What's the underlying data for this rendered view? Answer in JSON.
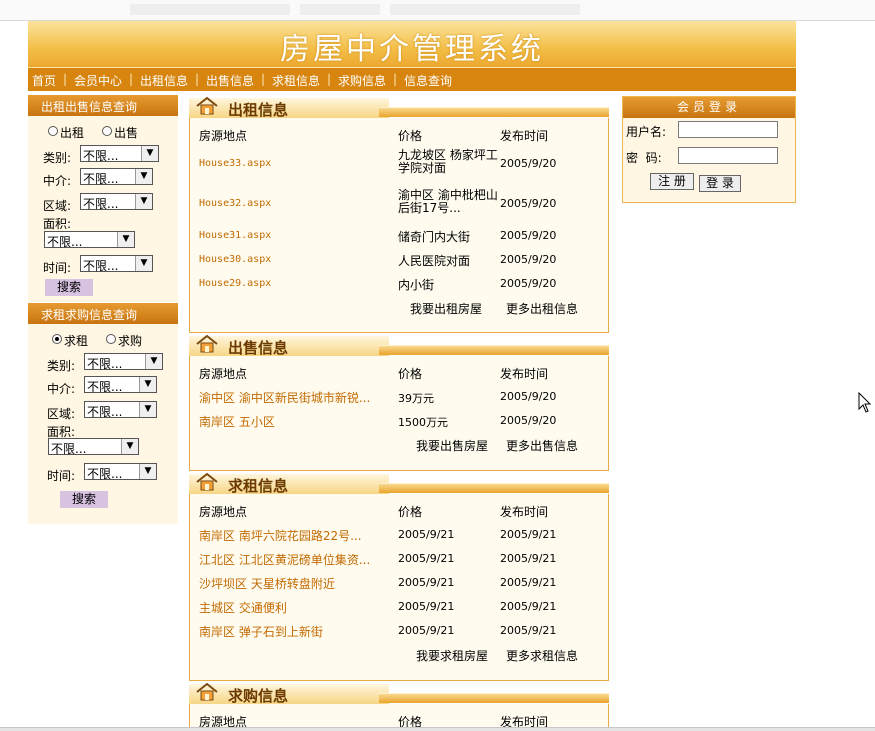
{
  "header": {
    "title": "房屋中介管理系统"
  },
  "nav": [
    "首页",
    "会员中心",
    "出租信息",
    "出售信息",
    "求租信息",
    "求购信息",
    "信息查询"
  ],
  "sidebar": {
    "rent_sale_search": {
      "heading": "出租出售信息查询",
      "radios": [
        {
          "label": "出租",
          "checked": false
        },
        {
          "label": "出售",
          "checked": false
        }
      ],
      "fields": {
        "category": "类别:",
        "agency": "中介:",
        "area": "区域:",
        "size": "面积:",
        "time": "时间:"
      },
      "select_value": "不限...",
      "search_label": "搜索"
    },
    "want_search": {
      "heading": "求租求购信息查询",
      "radios": [
        {
          "label": "求租",
          "checked": true
        },
        {
          "label": "求购",
          "checked": false
        }
      ],
      "fields": {
        "category": "类别:",
        "agency": "中介:",
        "area": "区域:",
        "size": "面积:",
        "time": "时间:"
      },
      "select_value": "不限...",
      "search_label": "搜索"
    }
  },
  "columns": {
    "location": "房源地点",
    "price": "价格",
    "date": "发布时间"
  },
  "rent": {
    "title": "出租信息",
    "rows": [
      {
        "location": "House33.aspx",
        "price": "九龙坡区 杨家坪工学院对面",
        "date": "2005/9/20"
      },
      {
        "location": "House32.aspx",
        "price": "渝中区 渝中枇杷山后街17号...",
        "date": "2005/9/20"
      },
      {
        "location": "House31.aspx",
        "price": "储奇门内大街",
        "date": "2005/9/20"
      },
      {
        "location": "House30.aspx",
        "price": "人民医院对面",
        "date": "2005/9/20"
      },
      {
        "location": "House29.aspx",
        "price": "内小街",
        "date": "2005/9/20"
      }
    ],
    "link_want": "我要出租房屋",
    "link_more": "更多出租信息"
  },
  "sale": {
    "title": "出售信息",
    "rows": [
      {
        "location": "渝中区 渝中区新民街城市新锐...",
        "price": "39万元",
        "date": "2005/9/20"
      },
      {
        "location": "南岸区 五小区",
        "price": "1500万元",
        "date": "2005/9/20"
      }
    ],
    "link_want": "我要出售房屋",
    "link_more": "更多出售信息"
  },
  "want_rent": {
    "title": "求租信息",
    "rows": [
      {
        "location": "南岸区 南坪六院花园路22号...",
        "price": "2005/9/21",
        "date": "2005/9/21"
      },
      {
        "location": "江北区 江北区黄泥磅单位集资...",
        "price": "2005/9/21",
        "date": "2005/9/21"
      },
      {
        "location": "沙坪坝区 天星桥转盘附近",
        "price": "2005/9/21",
        "date": "2005/9/21"
      },
      {
        "location": "主城区 交通便利",
        "price": "2005/9/21",
        "date": "2005/9/21"
      },
      {
        "location": "南岸区 弹子石到上新街",
        "price": "2005/9/21",
        "date": "2005/9/21"
      }
    ],
    "link_want": "我要求租房屋",
    "link_more": "更多求租信息"
  },
  "want_buy": {
    "title": "求购信息"
  },
  "login": {
    "title": "会员登录",
    "username_label": "用户名:",
    "password_label": "密  码:",
    "register": "注 册",
    "login": "登 录"
  },
  "colors": {
    "accent": "#d7850e",
    "link": "#c36a00",
    "panel_border": "#e7ab46"
  }
}
